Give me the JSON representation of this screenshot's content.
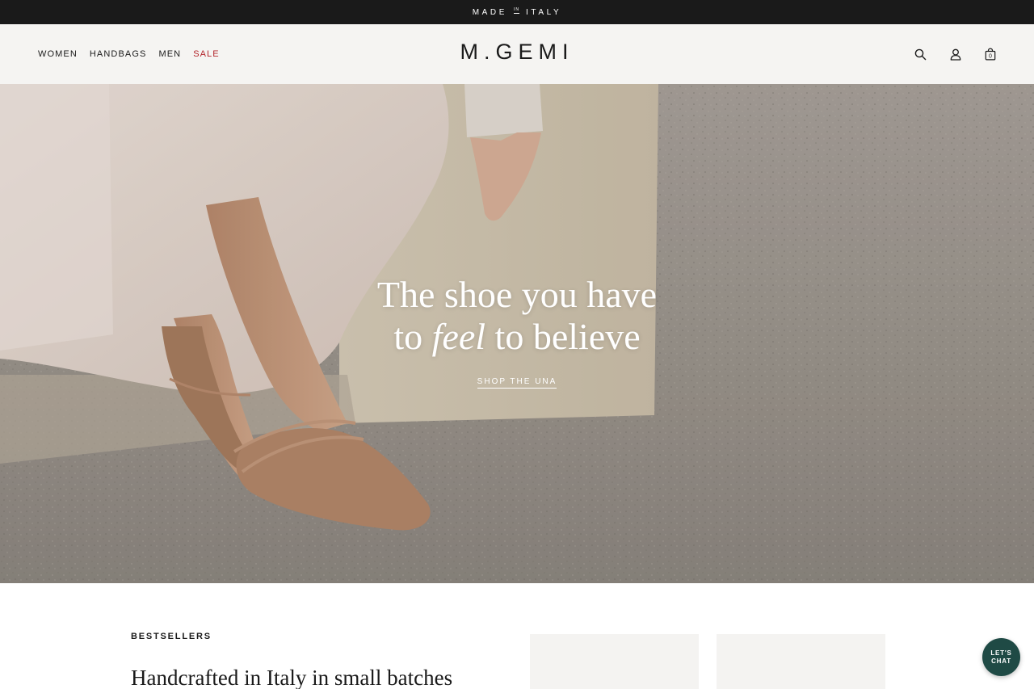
{
  "announcement": {
    "made": "MADE",
    "in": "IN",
    "italy": "ITALY"
  },
  "nav": {
    "items": [
      {
        "label": "WOMEN"
      },
      {
        "label": "HANDBAGS"
      },
      {
        "label": "MEN"
      },
      {
        "label": "SALE"
      }
    ]
  },
  "brand": {
    "logo": "M.GEMI"
  },
  "header_icons": [
    "search-icon",
    "account-icon",
    "cart-icon"
  ],
  "cart": {
    "count": "0"
  },
  "hero": {
    "headline_line1": "The shoe you have",
    "headline_pre": "to ",
    "headline_em": "feel",
    "headline_post": " to believe",
    "cta": "SHOP THE UNA"
  },
  "bestsellers": {
    "eyebrow": "BESTSELLERS",
    "subheading": "Handcrafted in Italy in small batches"
  },
  "chat": {
    "line1": "LET'S",
    "line2": "CHAT"
  },
  "colors": {
    "announcement_bg": "#1a1a1a",
    "header_bg": "#f5f4f2",
    "sale": "#b3262c",
    "chat_bg": "#1f4a45"
  }
}
